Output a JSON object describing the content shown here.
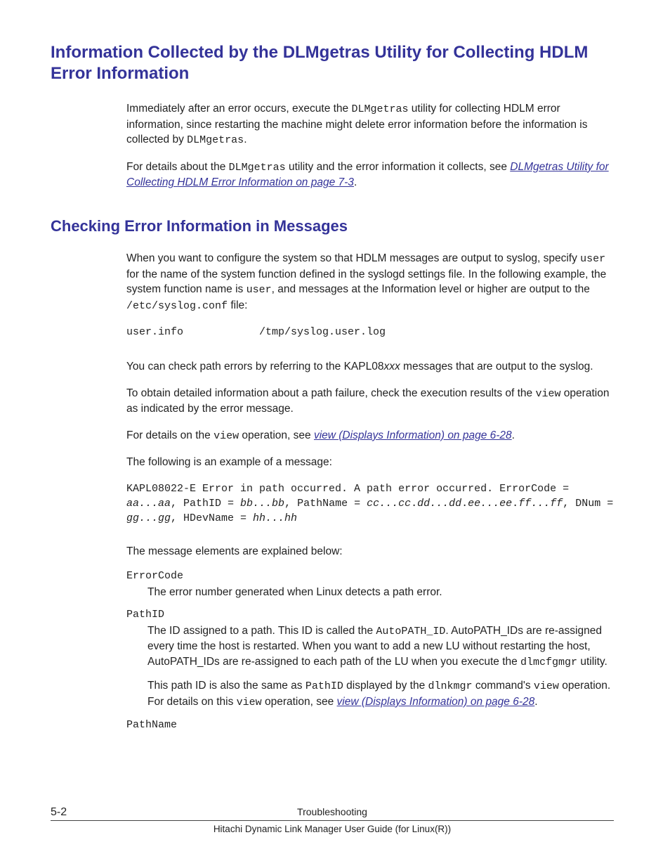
{
  "headings": {
    "h1": "Information Collected by the DLMgetras Utility for Collecting HDLM Error Information",
    "h2": "Checking Error Information in Messages"
  },
  "p1": {
    "a": "Immediately after an error occurs, execute the ",
    "code1": "DLMgetras",
    "b": " utility for collecting HDLM error information, since restarting the machine might delete error information before the information is collected by ",
    "code2": "DLMgetras",
    "c": "."
  },
  "p2": {
    "a": "For details about the ",
    "code1": "DLMgetras",
    "b": " utility and the error information it collects, see ",
    "link": "DLMgetras Utility for Collecting HDLM Error Information on page 7-3",
    "c": "."
  },
  "p3": {
    "a": "When you want to configure the system so that HDLM messages are output to syslog, specify ",
    "code1": "user",
    "b": " for the name of the system function defined in the syslogd settings file. In the following example, the system function name is ",
    "code2": "user",
    "c": ", and messages at the Information level or higher are output to the ",
    "code3": "/etc/syslog.conf",
    "d": " file:"
  },
  "pre1": "user.info            /tmp/syslog.user.log",
  "p4": {
    "a": "You can check path errors by referring to the KAPL08",
    "ital": "xxx",
    "b": " messages that are output to the syslog."
  },
  "p5": {
    "a": "To obtain detailed information about a path failure, check the execution results of the ",
    "code1": "view",
    "b": " operation as indicated by the error message."
  },
  "p6": {
    "a": "For details on the ",
    "code1": "view",
    "b": " operation, see ",
    "link": "view (Displays Information) on page 6-28",
    "c": "."
  },
  "p7": "The following is an example of a message:",
  "msg": {
    "a": "KAPL08022-E Error in path occurred. A path error occurred. ErrorCode = ",
    "i1": "aa...aa",
    "b": ", PathID = ",
    "i2": "bb...bb",
    "c": ", PathName = ",
    "i3": "cc...cc",
    "d": ".",
    "i4": "dd...dd",
    "e": ".",
    "i5": "ee...ee",
    "f": ".",
    "i6": "ff...ff",
    "g": ", DNum = ",
    "i7": "gg...gg",
    "h": ", HDevName = ",
    "i8": "hh...hh"
  },
  "p8": "The message elements are explained below:",
  "dl": {
    "t1": "ErrorCode",
    "d1": "The error number generated when Linux detects a path error.",
    "t2": "PathID",
    "d2a": {
      "a": "The ID assigned to a path. This ID is called the ",
      "code1": "AutoPATH_ID",
      "b": ". AutoPATH_IDs are re-assigned every time the host is restarted. When you want to add a new LU without restarting the host, AutoPATH_IDs are re-assigned to each path of the LU when you execute the ",
      "code2": "dlmcfgmgr",
      "c": " utility."
    },
    "d2b": {
      "a": "This path ID is also the same as ",
      "code1": "PathID",
      "b": " displayed by the ",
      "code2": "dlnkmgr",
      "c": " command's ",
      "code3": "view",
      "d": " operation. For details on this ",
      "code4": "view",
      "e": " operation, see ",
      "link": "view (Displays Information) on page 6-28",
      "f": "."
    },
    "t3": "PathName"
  },
  "footer": {
    "pnum": "5-2",
    "title1": "Troubleshooting",
    "title2": "Hitachi Dynamic Link Manager User Guide (for Linux(R))"
  }
}
